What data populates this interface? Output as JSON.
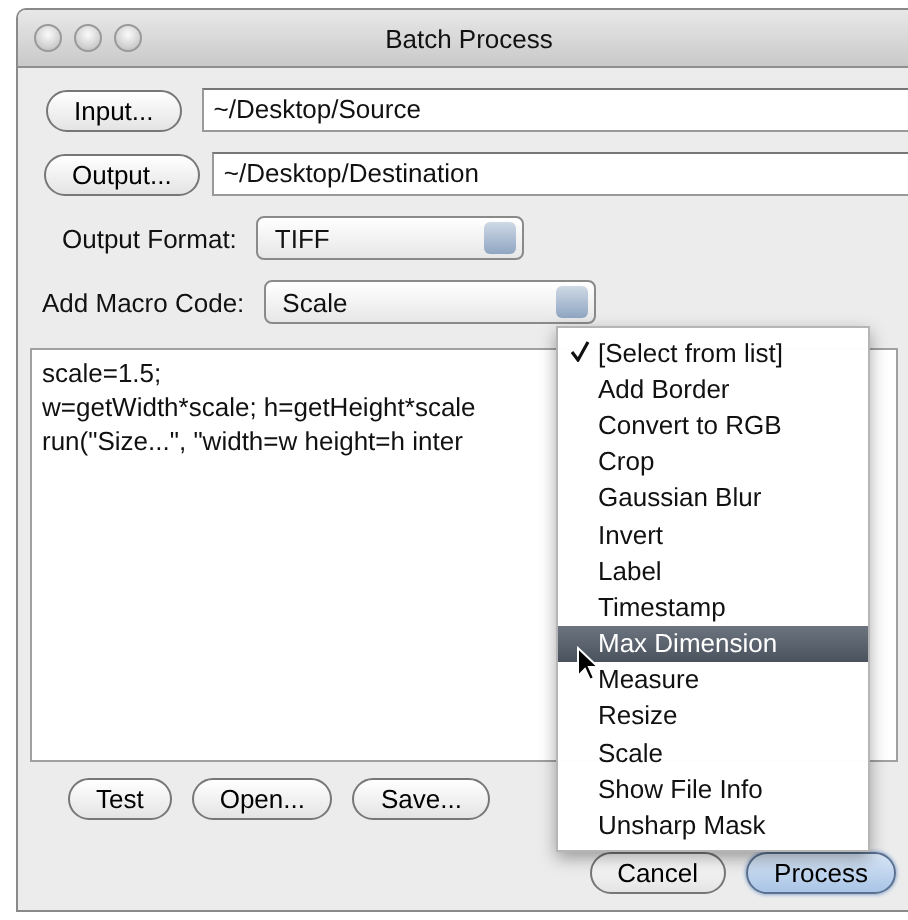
{
  "window": {
    "title": "Batch Process"
  },
  "input": {
    "button": "Input...",
    "value": "~/Desktop/Source"
  },
  "output": {
    "button": "Output...",
    "value": "~/Desktop/Destination"
  },
  "output_format": {
    "label": "Output Format:",
    "value": "TIFF"
  },
  "macro": {
    "label": "Add Macro Code:",
    "value": "Scale"
  },
  "code_lines": [
    "scale=1.5;",
    "w=getWidth*scale; h=getHeight*scale",
    "run(\"Size...\", \"width=w height=h inter"
  ],
  "buttons": [
    "Test",
    "Open...",
    "Save..."
  ],
  "dialog_buttons": [
    {
      "label": "Cancel",
      "default": false
    },
    {
      "label": "Process",
      "default": true
    }
  ],
  "menu": {
    "items": [
      {
        "label": "[Select from list]",
        "checked": true,
        "selected": false
      },
      {
        "label": "Add Border",
        "checked": false,
        "selected": false
      },
      {
        "label": "Convert to RGB",
        "checked": false,
        "selected": false
      },
      {
        "label": "Crop",
        "checked": false,
        "selected": false
      },
      {
        "label": "Gaussian Blur",
        "checked": false,
        "selected": false
      },
      {
        "label": "Invert",
        "checked": false,
        "selected": false
      },
      {
        "label": "Label",
        "checked": false,
        "selected": false
      },
      {
        "label": "Timestamp",
        "checked": false,
        "selected": false
      },
      {
        "label": "Max Dimension",
        "checked": false,
        "selected": true
      },
      {
        "label": "Measure",
        "checked": false,
        "selected": false
      },
      {
        "label": "Resize",
        "checked": false,
        "selected": false
      },
      {
        "label": "Scale",
        "checked": false,
        "selected": false
      },
      {
        "label": "Show File Info",
        "checked": false,
        "selected": false
      },
      {
        "label": "Unsharp Mask",
        "checked": false,
        "selected": false
      }
    ]
  }
}
